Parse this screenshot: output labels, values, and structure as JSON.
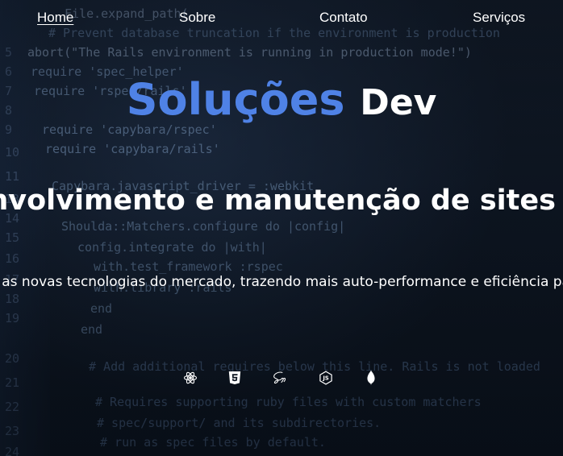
{
  "nav": {
    "items": [
      {
        "label": "Home",
        "active": true
      },
      {
        "label": "Sobre",
        "active": false
      },
      {
        "label": "Contato",
        "active": false
      },
      {
        "label": "Serviços",
        "active": false
      }
    ]
  },
  "hero": {
    "brand_primary": "Soluções",
    "brand_secondary": "Dev",
    "headline": "Desenvolvimento e manutenção de sites e sistemas",
    "subline": "Com as novas tecnologias do mercado, trazendo mais auto-performance e eficiência para você"
  },
  "tech_icons": [
    "react-icon",
    "html5-icon",
    "sass-icon",
    "nodejs-icon",
    "mongodb-icon"
  ],
  "colors": {
    "brand_accent": "#4f82e6",
    "text": "#ffffff",
    "background": "#0d1520"
  }
}
